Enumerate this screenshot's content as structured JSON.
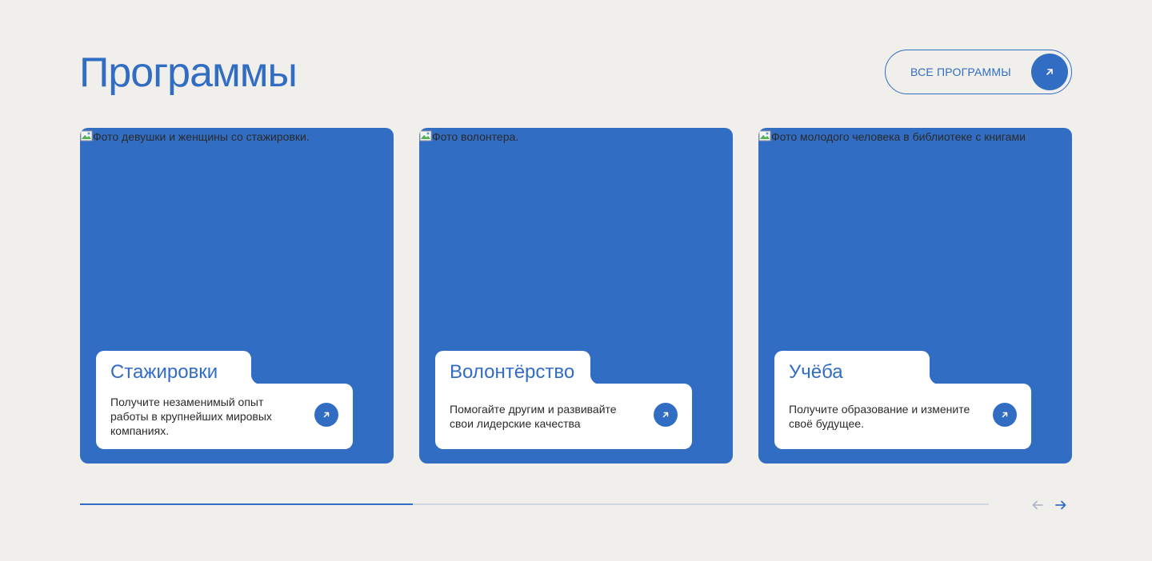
{
  "header": {
    "title": "Программы",
    "all_programs_label": "Все программы"
  },
  "cards": [
    {
      "image_alt": "Фото девушки и женщины со стажировки.",
      "title": "Стажировки",
      "description": "Получите незаменимый опыт работы в крупнейших мировых компаниях."
    },
    {
      "image_alt": "Фото волонтера.",
      "title": "Волонтёрство",
      "description": "Помогайте другим и развивайте свои лидерские качества"
    },
    {
      "image_alt": "Фото молодого человека в библиотеке с книгами",
      "title": "Учёба",
      "description": "Получите образование и измените своё будущее."
    }
  ],
  "carousel": {
    "progress_percent": 36.6,
    "prev_icon": "arrow-left-icon",
    "next_icon": "arrow-right-icon"
  },
  "colors": {
    "accent": "#326dc4",
    "background": "#f0efeb",
    "card_panel": "#ffffff",
    "progress_track": "#cfd6e2",
    "nav_disabled": "#a9b4c6"
  }
}
